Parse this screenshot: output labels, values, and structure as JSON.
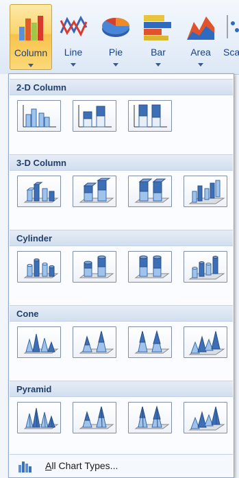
{
  "ribbon": {
    "buttons": [
      {
        "label": "Column",
        "icon": "column-chart-icon",
        "active": true
      },
      {
        "label": "Line",
        "icon": "line-chart-icon"
      },
      {
        "label": "Pie",
        "icon": "pie-chart-icon"
      },
      {
        "label": "Bar",
        "icon": "bar-chart-icon"
      },
      {
        "label": "Area",
        "icon": "area-chart-icon"
      },
      {
        "label": "Sca",
        "icon": "scatter-chart-icon"
      }
    ]
  },
  "gallery": {
    "sections": [
      {
        "title": "2-D Column",
        "icons": [
          "clustered-column-icon",
          "stacked-column-icon",
          "100-stacked-column-icon"
        ]
      },
      {
        "title": "3-D Column",
        "icons": [
          "3d-clustered-column-icon",
          "3d-stacked-column-icon",
          "3d-100-stacked-column-icon",
          "3d-column-icon"
        ]
      },
      {
        "title": "Cylinder",
        "icons": [
          "clustered-cylinder-icon",
          "stacked-cylinder-icon",
          "100-stacked-cylinder-icon",
          "3d-cylinder-icon"
        ]
      },
      {
        "title": "Cone",
        "icons": [
          "clustered-cone-icon",
          "stacked-cone-icon",
          "100-stacked-cone-icon",
          "3d-cone-icon"
        ]
      },
      {
        "title": "Pyramid",
        "icons": [
          "clustered-pyramid-icon",
          "stacked-pyramid-icon",
          "100-stacked-pyramid-icon",
          "3d-pyramid-icon"
        ]
      }
    ]
  },
  "footer": {
    "label": "All Chart Types...",
    "icon": "chart-types-icon"
  },
  "colors": {
    "active_button": "#fbd56a",
    "header_text": "#1f3f6a",
    "ribbon_label": "#15428b"
  }
}
